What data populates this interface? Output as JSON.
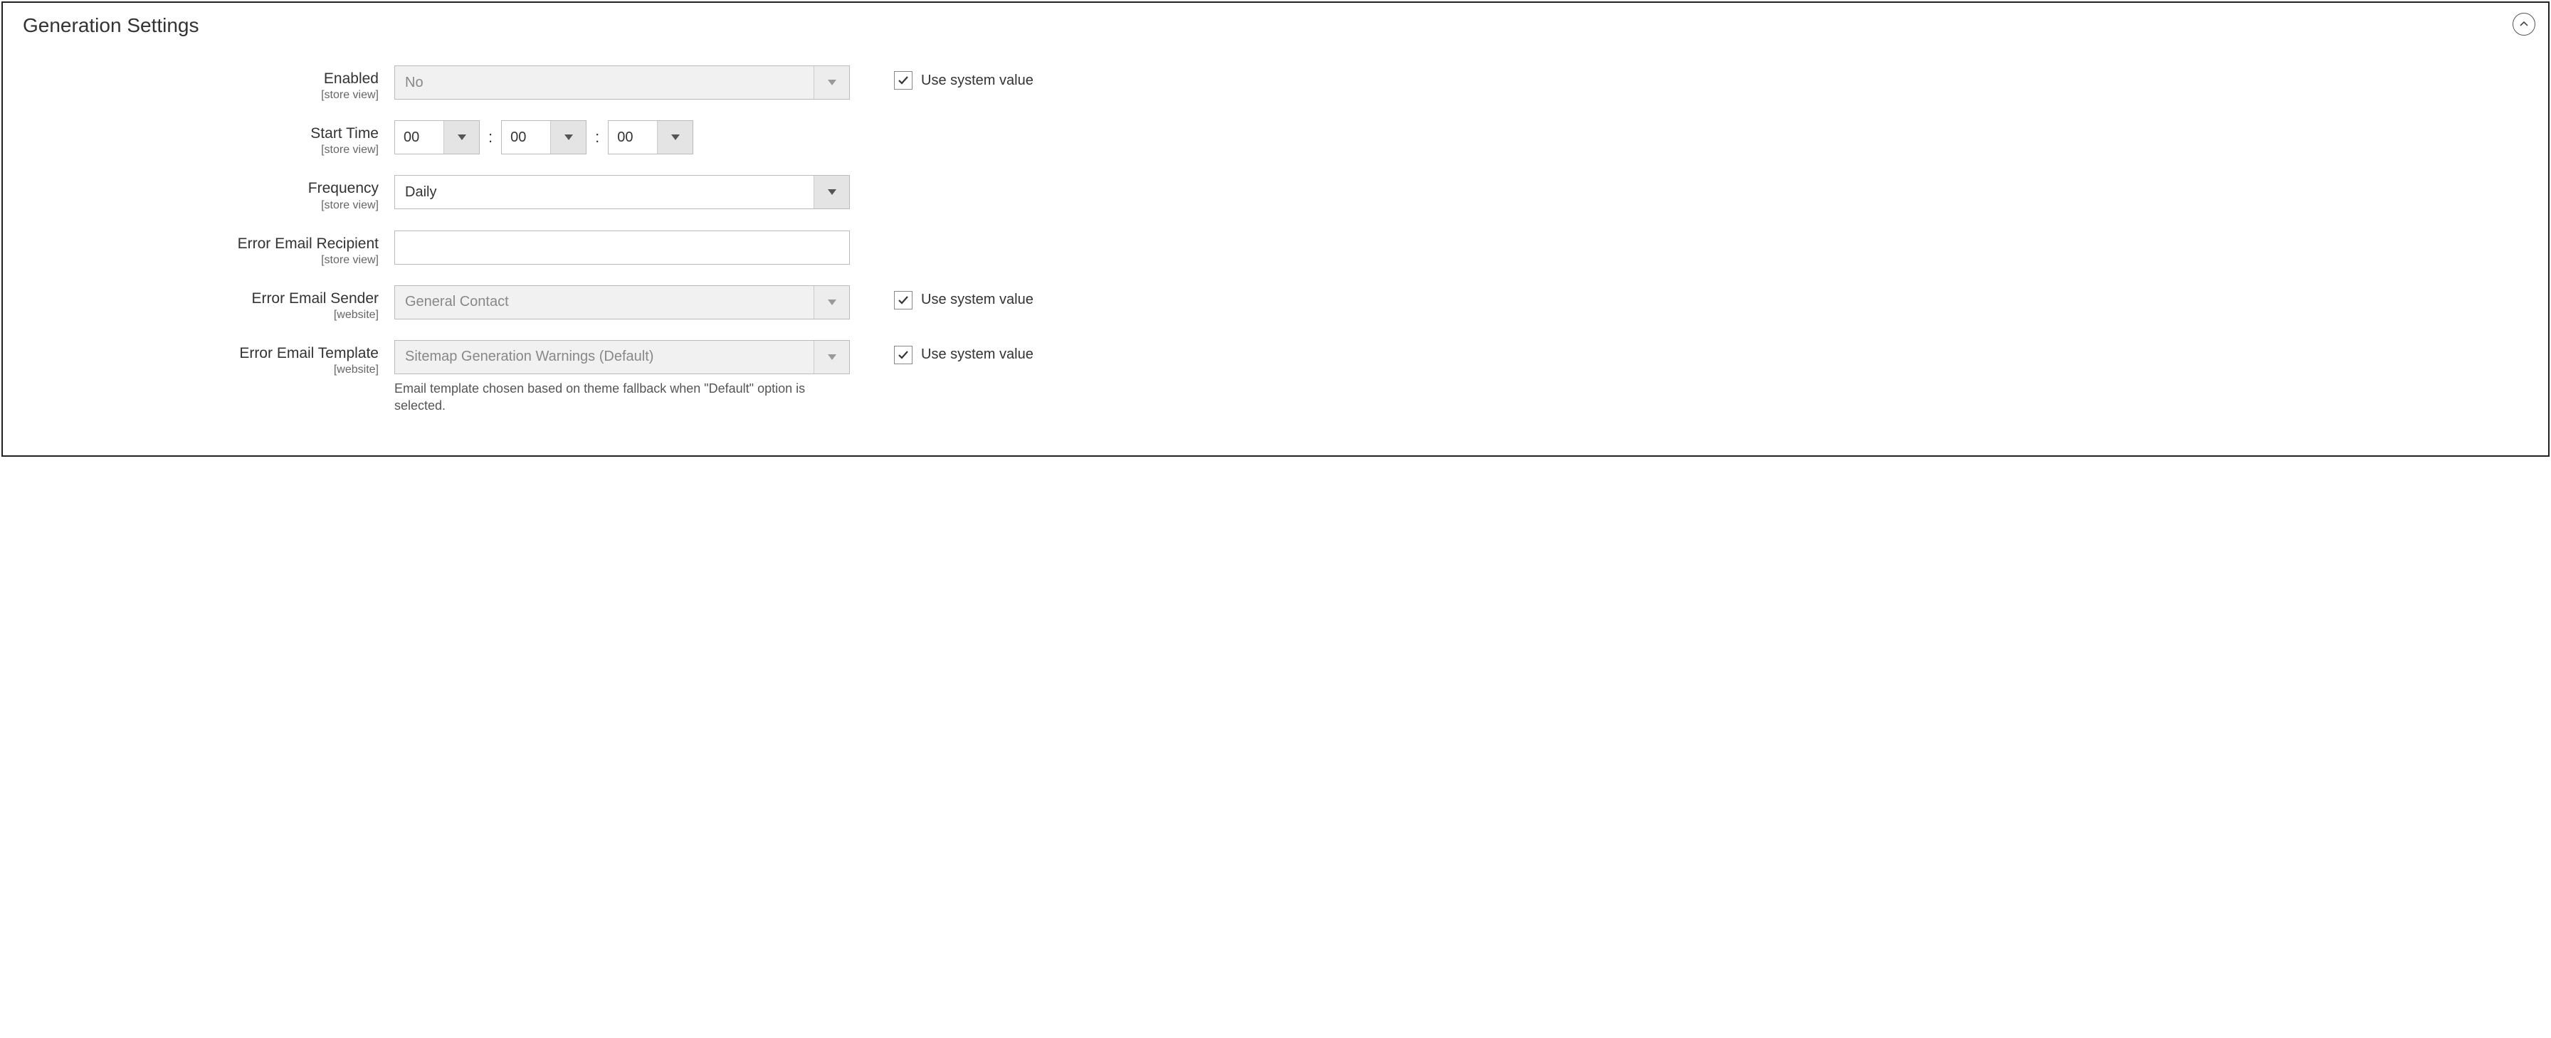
{
  "section": {
    "title": "Generation Settings"
  },
  "scope": {
    "store_view": "[store view]",
    "website": "[website]"
  },
  "common": {
    "use_system_value": "Use system value",
    "time_separator": ":"
  },
  "fields": {
    "enabled": {
      "label": "Enabled",
      "value": "No"
    },
    "start_time": {
      "label": "Start Time",
      "hh": "00",
      "mm": "00",
      "ss": "00"
    },
    "frequency": {
      "label": "Frequency",
      "value": "Daily"
    },
    "error_recipient": {
      "label": "Error Email Recipient",
      "value": ""
    },
    "error_sender": {
      "label": "Error Email Sender",
      "value": "General Contact"
    },
    "error_template": {
      "label": "Error Email Template",
      "value": "Sitemap Generation Warnings (Default)",
      "help": "Email template chosen based on theme fallback when \"Default\" option is selected."
    }
  }
}
